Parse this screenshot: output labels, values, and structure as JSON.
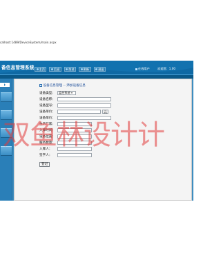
{
  "browser": {
    "url": "calhost:1489/DeviceSystem/main.aspx"
  },
  "header": {
    "system_title": "备信息管理系统",
    "nav": [
      {
        "label": "主页",
        "icon": "home-icon"
      },
      {
        "label": "后退",
        "icon": "back-icon"
      },
      {
        "label": "前进",
        "icon": "forward-icon"
      },
      {
        "label": "刷新",
        "icon": "refresh-icon"
      },
      {
        "label": "退出",
        "icon": "exit-icon"
      }
    ],
    "online_label": "在线用户",
    "welcome": "欢迎您：1.00"
  },
  "content": {
    "breadcrumb": "设备信息管理 -- 添加设备信息",
    "form": {
      "type_label": "设备类型：",
      "type_value": "监控系统",
      "name_label": "设备名称：",
      "number_label": "设备型号：",
      "price_label": "设备单价：",
      "price_unit": "元",
      "qty_label": "设备单价：",
      "purchase_label": "生产厂家：",
      "date_label": "入库时间：",
      "location_label": "设备位置：",
      "service_label": "服务数量：",
      "entry_label": "入库人：",
      "approve_label": "签字人：",
      "submit_label": "登记"
    }
  },
  "watermark": "双鱼林设计计"
}
